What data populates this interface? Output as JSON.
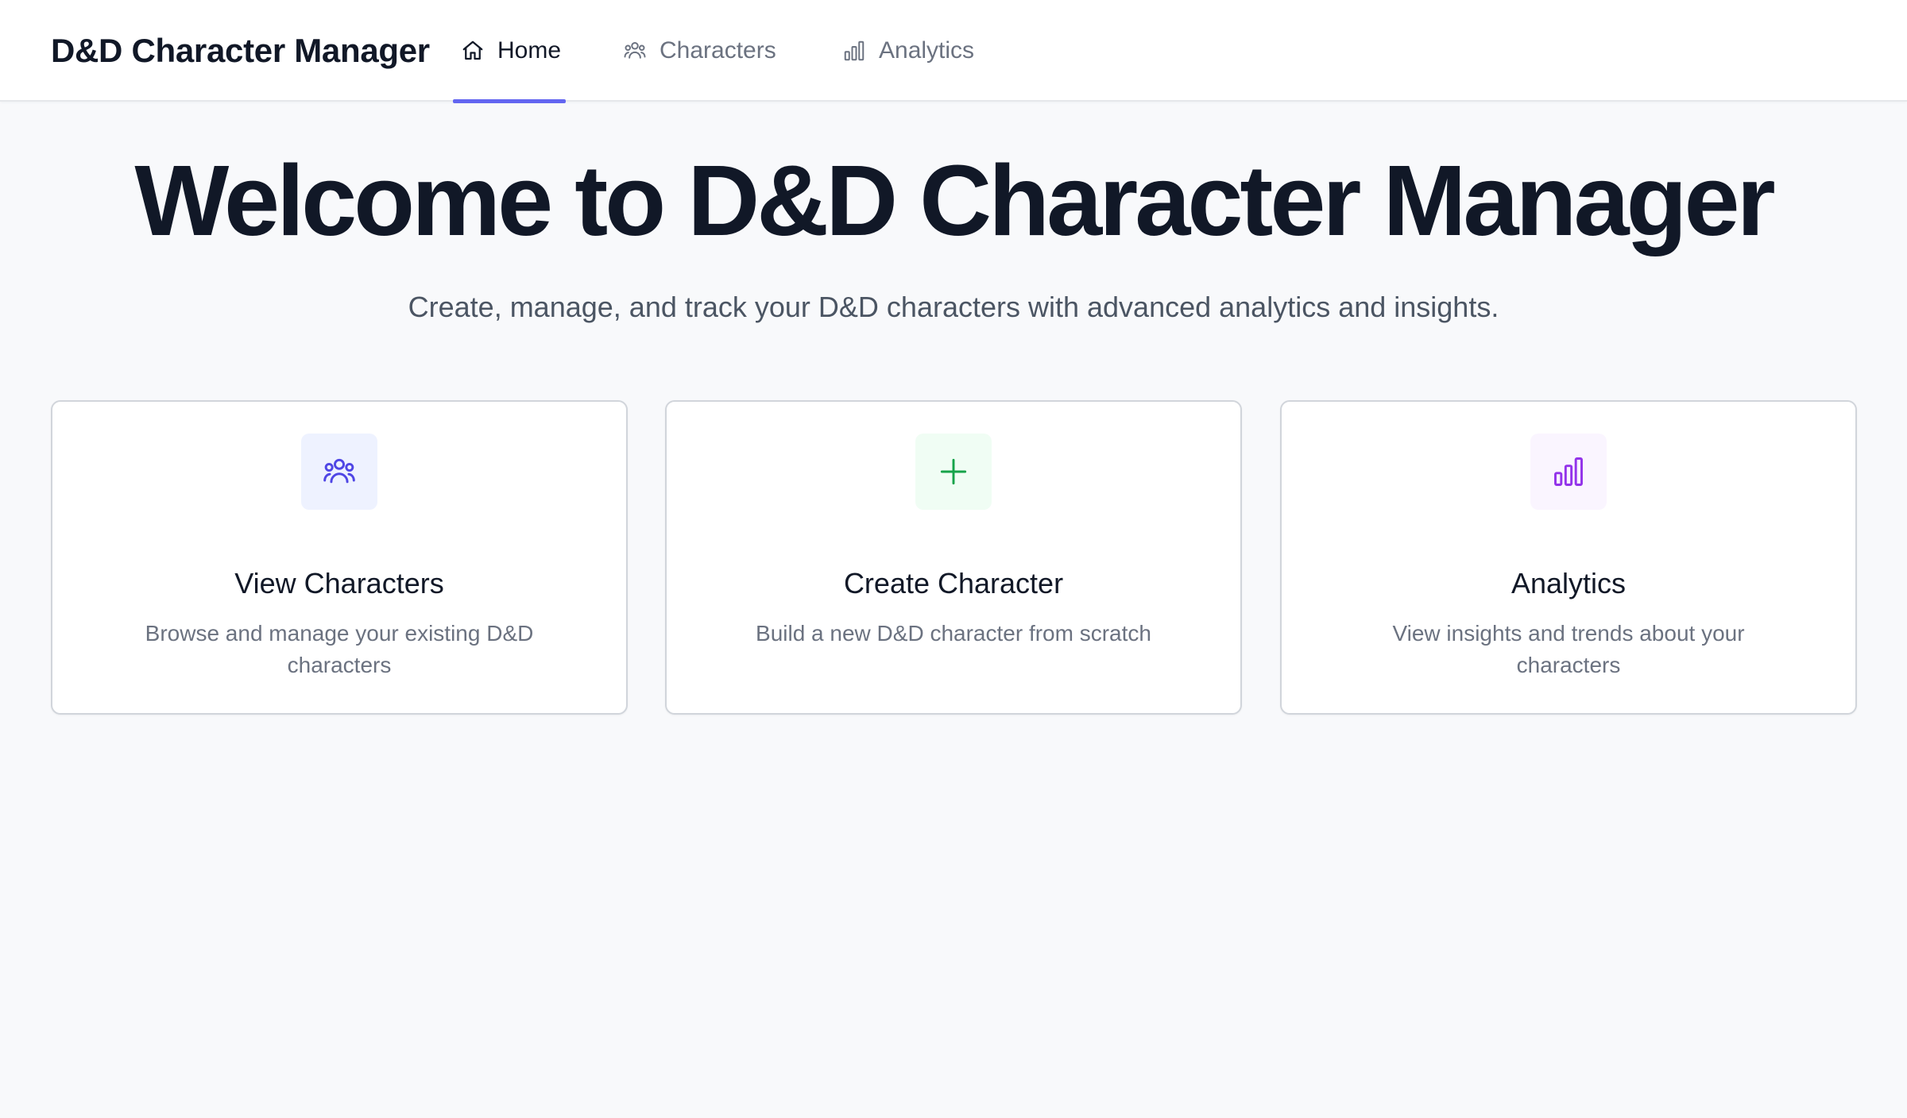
{
  "app": {
    "title": "D&D Character Manager"
  },
  "nav": {
    "tabs": [
      {
        "label": "Home",
        "icon": "home-icon",
        "active": true
      },
      {
        "label": "Characters",
        "icon": "users-icon",
        "active": false
      },
      {
        "label": "Analytics",
        "icon": "bar-chart-icon",
        "active": false
      }
    ],
    "active_underline_color": "#6366f1"
  },
  "hero": {
    "title": "Welcome to D&D Character Manager",
    "subtitle": "Create, manage, and track your D&D characters with advanced analytics and insights."
  },
  "cards": [
    {
      "title": "View Characters",
      "description": "Browse and manage your existing D&D characters",
      "icon": "users-icon",
      "icon_color": "#4f46e5",
      "icon_bg": "#eef2ff"
    },
    {
      "title": "Create Character",
      "description": "Build a new D&D character from scratch",
      "icon": "plus-icon",
      "icon_color": "#16a34a",
      "icon_bg": "#f0fdf4"
    },
    {
      "title": "Analytics",
      "description": "View insights and trends about your characters",
      "icon": "bar-chart-icon",
      "icon_color": "#9333ea",
      "icon_bg": "#faf5ff"
    }
  ]
}
